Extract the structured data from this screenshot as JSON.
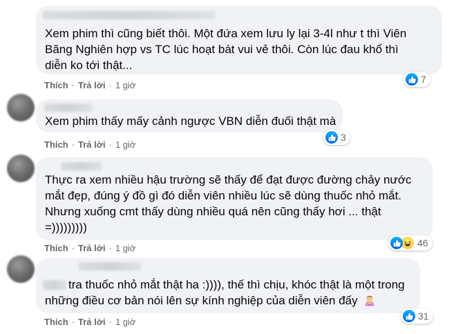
{
  "comments": [
    {
      "lines": [
        "Xem phim thì cũng biết thôi. Một đứa xem lưu ly lại 3-4l như t thì Viên",
        "Băng Nghiên hợp vs TC lúc hoạt bát vui vẻ thôi. Còn lúc đau khổ thì",
        "diễn ko tới thật..."
      ],
      "like_label": "Thích",
      "reply_label": "Trả lời",
      "time": "1 giờ",
      "reaction_count": "7",
      "reactions": [
        "like-icon"
      ]
    },
    {
      "lines": [
        "Xem phim thấy mấy cảnh ngược VBN diễn đuối thật mà"
      ],
      "like_label": "Thích",
      "reply_label": "Trả lời",
      "time": "1 giờ",
      "reaction_count": "3",
      "reactions": [
        "like-icon"
      ]
    },
    {
      "lines": [
        "Thực ra xem nhiều hậu trường sẽ thấy để đạt được đường chảy nước",
        "mắt đẹp, đúng ý đồ gì đó diễn viên nhiều lúc sẽ dùng thuốc nhỏ mắt.",
        "Nhưng xuống cmt thấy dùng nhiều quá nên cũng thấy hơi ... thật",
        "=)))))))))"
      ],
      "like_label": "Thích",
      "reply_label": "Trả lời",
      "time": "1 giờ",
      "reaction_count": "46",
      "reactions": [
        "like-icon",
        "haha-icon"
      ]
    },
    {
      "lines": [
        "tra thuốc nhỏ mắt thật ha :)))), thế thì chịu, khóc thật là một trong",
        "những điều cơ bản nói lên sự kính nghiệp của diễn viên đấy"
      ],
      "like_label": "Thích",
      "reply_label": "Trả lời",
      "time": "1 giờ",
      "reaction_count": "31",
      "reactions": [
        "like-icon"
      ],
      "trailing_emoji": "person-gesturing-no-emoji"
    }
  ],
  "colors": {
    "bubble": "#f0f2f5",
    "text": "#050505",
    "meta": "#65676b",
    "like_blue": "#1877f2"
  }
}
